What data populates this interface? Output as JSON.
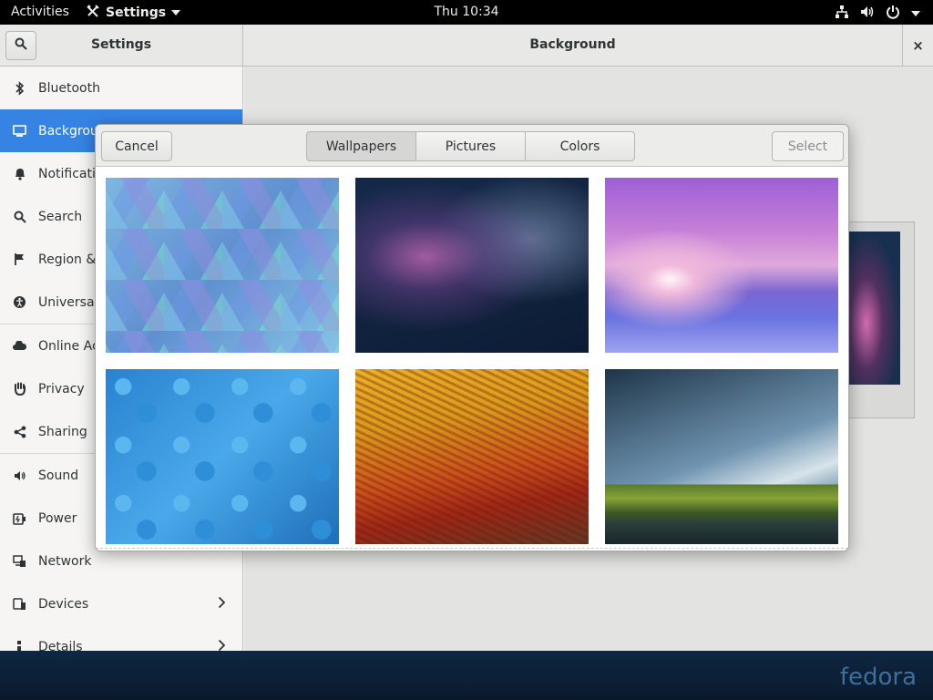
{
  "topbar": {
    "activities": "Activities",
    "app_menu": "Settings",
    "clock": "Thu 10:34",
    "tray_icons": [
      "network-icon",
      "volume-icon",
      "power-icon"
    ]
  },
  "window": {
    "sidebar_title": "Settings",
    "content_title": "Background",
    "close": "×"
  },
  "sidebar": {
    "items": [
      {
        "label": "Bluetooth",
        "icon": "bluetooth-icon"
      },
      {
        "label": "Background",
        "icon": "display-icon"
      },
      {
        "label": "Notifications",
        "icon": "bell-icon"
      },
      {
        "label": "Search",
        "icon": "search-icon"
      },
      {
        "label": "Region & Language",
        "icon": "flag-icon"
      },
      {
        "label": "Universal Access",
        "icon": "accessibility-icon"
      },
      {
        "label": "Online Accounts",
        "icon": "cloud-icon"
      },
      {
        "label": "Privacy",
        "icon": "hand-icon"
      },
      {
        "label": "Sharing",
        "icon": "share-icon"
      },
      {
        "label": "Sound",
        "icon": "speaker-icon"
      },
      {
        "label": "Power",
        "icon": "battery-icon"
      },
      {
        "label": "Network",
        "icon": "network-icon"
      },
      {
        "label": "Devices",
        "icon": "devices-icon"
      },
      {
        "label": "Details",
        "icon": "info-icon"
      }
    ]
  },
  "dialog": {
    "cancel": "Cancel",
    "select": "Select",
    "tabs": [
      "Wallpapers",
      "Pictures",
      "Colors"
    ],
    "selected_tab": "Wallpapers"
  },
  "branding": {
    "logo": "fedora"
  },
  "colors": {
    "accent": "#3584e4",
    "topbar": "#000000",
    "panel": "#0c1e33"
  }
}
